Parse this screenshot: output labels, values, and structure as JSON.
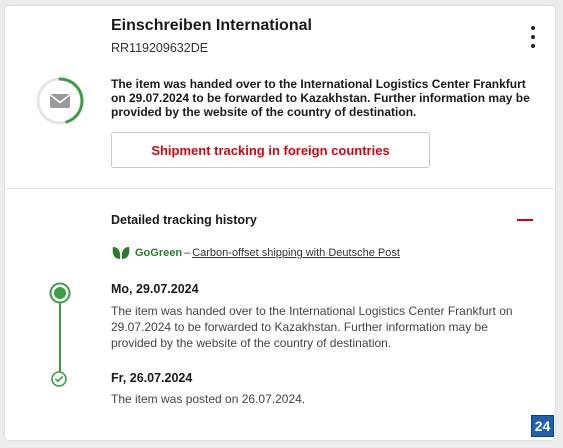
{
  "shipment": {
    "title": "Einschreiben International",
    "tracking_number": "RR119209632DE",
    "status_icon": "envelope-icon",
    "status_text": "The item was handed over to the International Logistics Center Frankfurt on 29.07.2024 to be forwarded to Kazakhstan. Further information may be provided by the website of the country of destination.",
    "status_progress": 0.45,
    "foreign_tracking_button": "Shipment tracking in foreign countries"
  },
  "history": {
    "title": "Detailed tracking history",
    "gogreen": {
      "brand": "GoGreen",
      "separator": "–",
      "link_text": "Carbon-offset shipping with Deutsche Post"
    },
    "events": [
      {
        "date": "Mo, 29.07.2024",
        "text": "The item was handed over to the International Logistics Center Frankfurt on 29.07.2024 to be forwarded to Kazakhstan. Further information may be provided by the website of the country of destination."
      },
      {
        "date": "Fr, 26.07.2024",
        "text": "The item was posted on 26.07.2024."
      }
    ]
  },
  "badge": {
    "label": "24"
  },
  "colors": {
    "accent_red": "#d40511",
    "timeline_green": "#3aa048",
    "badge_blue": "#1f5fb4"
  }
}
